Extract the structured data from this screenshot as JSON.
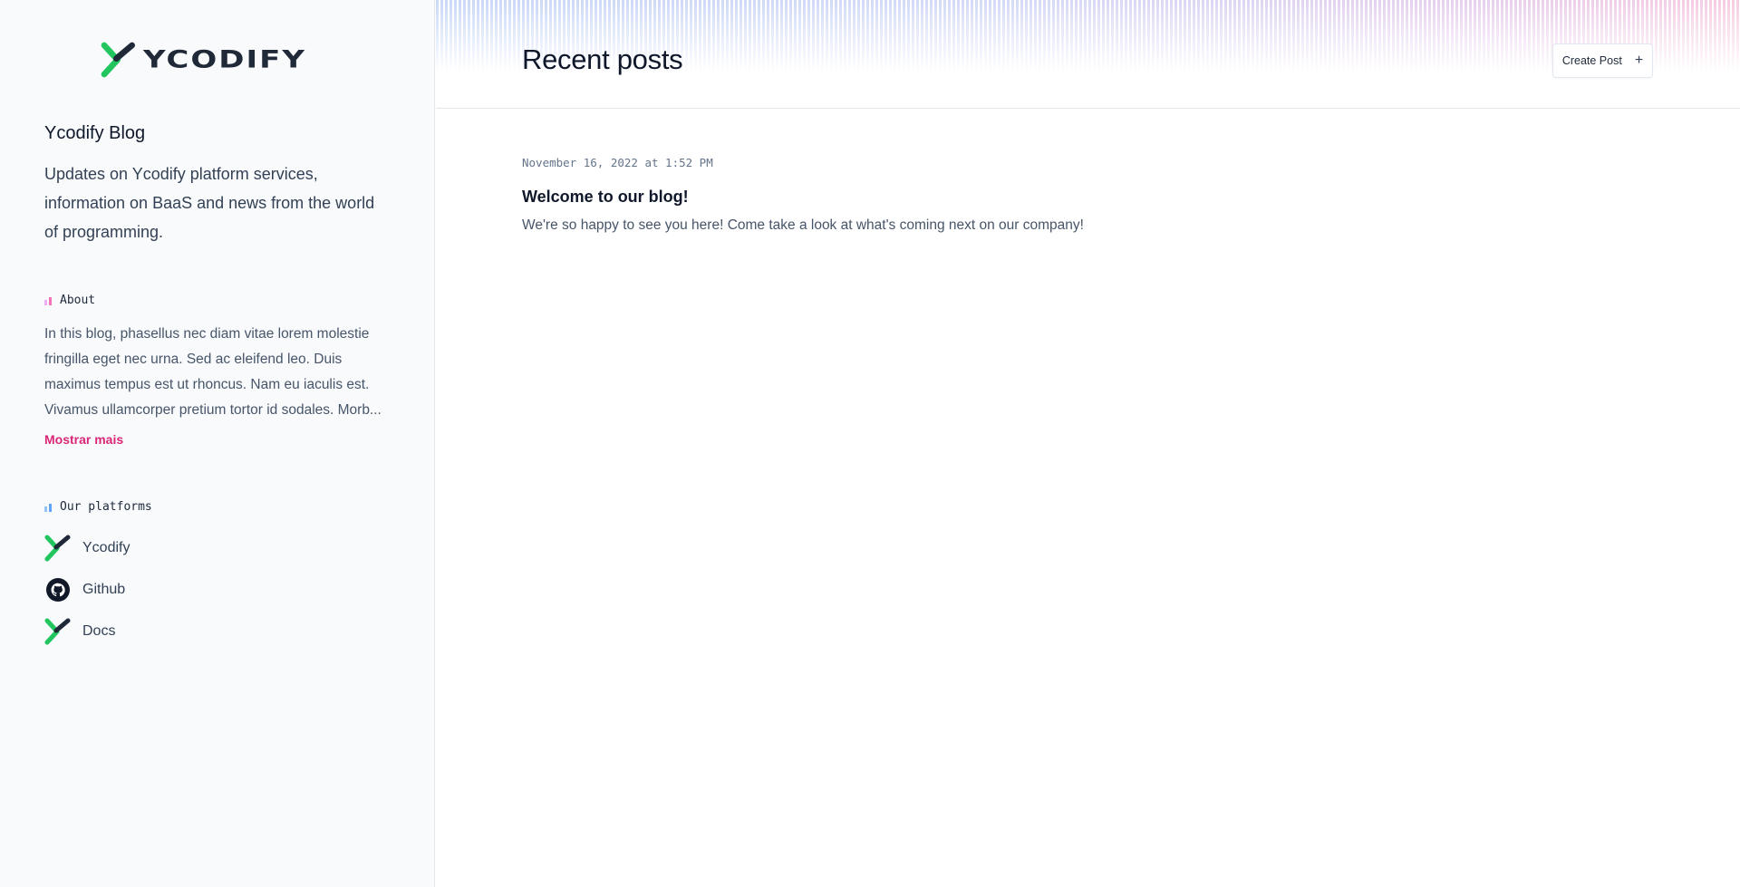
{
  "brand": {
    "logo_text": "YCODIFY",
    "accent": "#22c55e",
    "dark": "#1f2937"
  },
  "sidebar": {
    "blog_title": "Ycodify Blog",
    "blog_description": "Updates on Ycodify platform services, information on BaaS and news from the world of programming.",
    "about": {
      "heading": "About",
      "text": "In this blog, phasellus nec diam vitae lorem molestie fringilla eget nec urna. Sed ac eleifend leo. Duis maximus tempus est ut rhoncus. Nam eu iaculis est. Vivamus ullamcorper pretium tortor id sodales. Morb...",
      "show_more": "Mostrar mais",
      "icon_colors": [
        "#f0abfc",
        "#f472b6"
      ]
    },
    "platforms": {
      "heading": "Our platforms",
      "icon_colors": [
        "#93c5fd",
        "#60a5fa"
      ],
      "items": [
        {
          "label": "Ycodify",
          "icon": "ycodify-logo-icon"
        },
        {
          "label": "Github",
          "icon": "github-icon"
        },
        {
          "label": "Docs",
          "icon": "ycodify-logo-icon"
        }
      ]
    }
  },
  "main": {
    "title": "Recent posts",
    "create_button": "Create Post",
    "create_icon": "+",
    "posts": [
      {
        "date": "November 16, 2022 at 1:52 PM",
        "title": "Welcome to our blog!",
        "excerpt": "We're so happy to see you here! Come take a look at what's coming next on our company!"
      }
    ]
  }
}
